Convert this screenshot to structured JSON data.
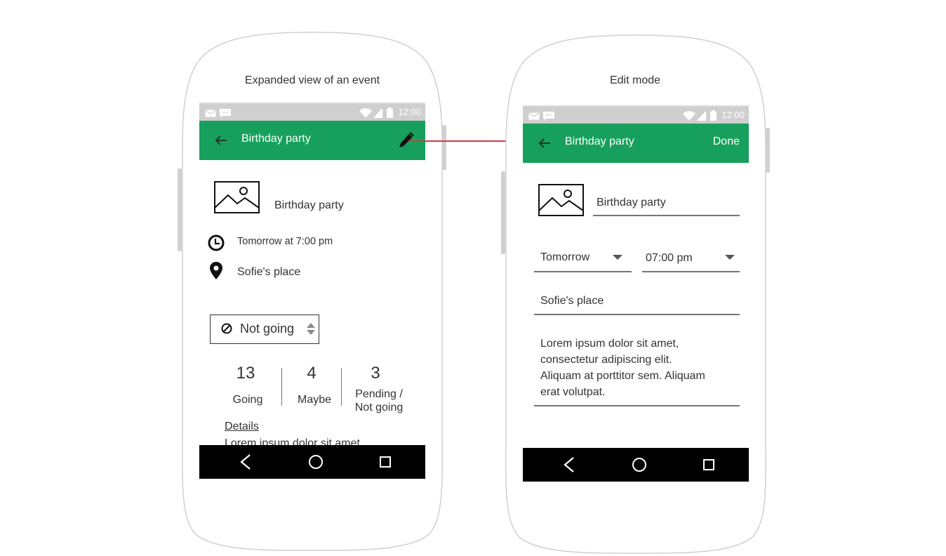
{
  "left": {
    "caption": "Expanded view of an event",
    "status_time": "12:00",
    "title": "Birthday party",
    "event_name": "Birthday party",
    "time_text": "Tomorrow at 7:00 pm",
    "location_text": "Sofie's place",
    "rsvp_value": "Not going",
    "stats": [
      {
        "count": "13",
        "label": "Going"
      },
      {
        "count": "4",
        "label": "Maybe"
      },
      {
        "count": "3",
        "label_line1": "Pending /",
        "label_line2": "Not going"
      }
    ],
    "details_link": "Details",
    "details_preview": "Lorem ipsum dolor sit amet,"
  },
  "right": {
    "caption": "Edit mode",
    "status_time": "12:00",
    "title": "Birthday party",
    "done_label": "Done",
    "name_value": "Birthday party",
    "date_value": "Tomorrow",
    "time_value": "07:00 pm",
    "location_value": "Sofie's place",
    "description_lines": [
      "Lorem ipsum dolor sit amet,",
      "consectetur adipiscing elit.",
      "Aliquam at porttitor sem. Aliquam",
      "erat volutpat."
    ]
  },
  "colors": {
    "app_bar": "#17a05d",
    "arrow": "#d23b3b",
    "status_bar": "#cfcfcf"
  }
}
